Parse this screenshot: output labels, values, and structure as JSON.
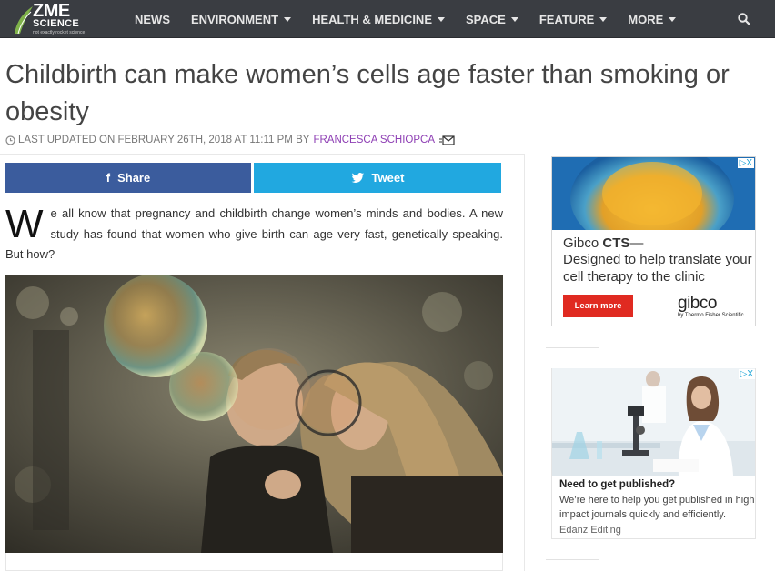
{
  "site": {
    "logo_main": "ZME",
    "logo_sub": "SCIENCE",
    "logo_tagline": "not exactly rocket science"
  },
  "nav": {
    "items": [
      {
        "label": "NEWS",
        "has_caret": false
      },
      {
        "label": "ENVIRONMENT",
        "has_caret": true
      },
      {
        "label": "HEALTH & MEDICINE",
        "has_caret": true
      },
      {
        "label": "SPACE",
        "has_caret": true
      },
      {
        "label": "FEATURE",
        "has_caret": true
      },
      {
        "label": "MORE",
        "has_caret": true
      }
    ],
    "search_icon": "search-icon"
  },
  "article": {
    "title": "Childbirth can make women’s cells age faster than smoking or obesity",
    "meta_prefix": "LAST UPDATED ON FEBRUARY 26TH, 2018 AT 11:11 PM BY",
    "author": "FRANCESCA SCHIOPCA",
    "dropcap": "W",
    "intro": "e all know that pregnancy and childbirth change women’s minds and bodies. A new study has found that women who give birth can age very fast, genetically speaking. But how?"
  },
  "share": {
    "facebook_label": "Share",
    "twitter_label": "Tweet"
  },
  "ads": {
    "ad1": {
      "headline_brand": "Gibco",
      "headline_product": "CTS",
      "headline_dash": "—",
      "body": "Designed to help translate your cell therapy to the clinic",
      "cta": "Learn more",
      "brand": "gibco",
      "brand_sub": "by Thermo Fisher Scientific",
      "adchoices": "▷X"
    },
    "ad2": {
      "headline": "Need to get published?",
      "body": "We’re here to help you get published in high\nimpact journals quickly and efficiently.",
      "source": "Edanz Editing",
      "adchoices": "▷X"
    }
  },
  "colors": {
    "nav_bg": "#3a3d42",
    "facebook": "#3b5c9d",
    "twitter": "#21a8e0",
    "author_link": "#8e3fb4",
    "cta_red": "#e02a21"
  }
}
